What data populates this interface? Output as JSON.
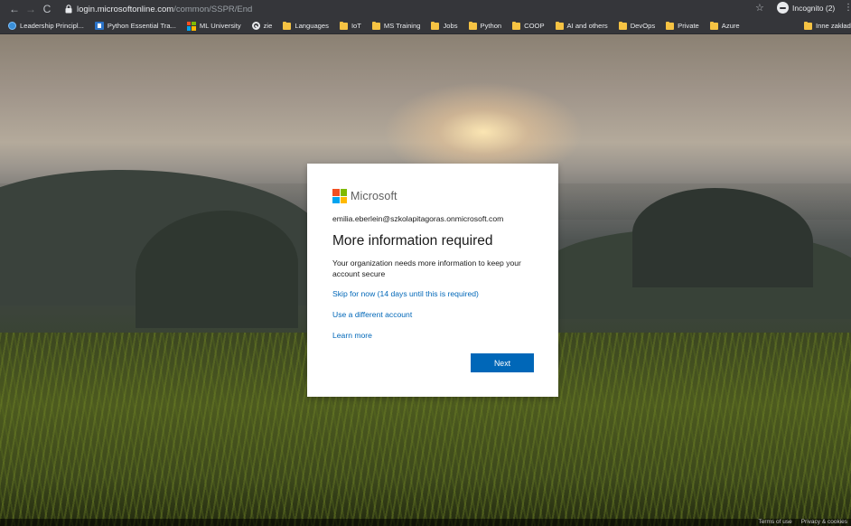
{
  "browser": {
    "url_host": "login.microsoftonline.com",
    "url_path": "/common/SSPR/End",
    "profile_label": "Incognito (2)",
    "bookmarks": [
      {
        "label": "Leadership Principl...",
        "icon": "globe-icon"
      },
      {
        "label": "Python Essential Tra...",
        "icon": "python-course-icon"
      },
      {
        "label": "ML University",
        "icon": "ms-squares-icon"
      },
      {
        "label": "zie",
        "icon": "blocked-icon"
      },
      {
        "label": "Languages",
        "icon": "folder-icon"
      },
      {
        "label": "IoT",
        "icon": "folder-icon"
      },
      {
        "label": "MS Training",
        "icon": "folder-icon"
      },
      {
        "label": "Jobs",
        "icon": "folder-icon"
      },
      {
        "label": "Python",
        "icon": "folder-icon"
      },
      {
        "label": "COOP",
        "icon": "folder-icon"
      },
      {
        "label": "AI and others",
        "icon": "folder-icon"
      },
      {
        "label": "DevOps",
        "icon": "folder-icon"
      },
      {
        "label": "Private",
        "icon": "folder-icon"
      },
      {
        "label": "Azure",
        "icon": "folder-icon"
      }
    ],
    "other_bookmarks": "Inne zakładki"
  },
  "card": {
    "brand": "Microsoft",
    "identity": "emilia.eberlein@szkolapitagoras.onmicrosoft.com",
    "heading": "More information required",
    "description": "Your organization needs more information to keep your account secure",
    "skip_link": "Skip for now (14 days until this is required)",
    "different_account_link": "Use a different account",
    "learn_more_link": "Learn more",
    "next_button": "Next"
  },
  "footer": {
    "terms": "Terms of use",
    "privacy": "Privacy & cookies"
  },
  "colors": {
    "accent": "#0067b8",
    "ms_red": "#f25022",
    "ms_green": "#7fba00",
    "ms_blue": "#00a4ef",
    "ms_yellow": "#ffb900"
  }
}
